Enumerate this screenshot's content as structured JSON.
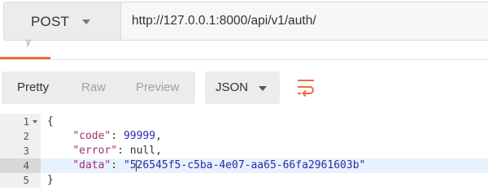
{
  "request": {
    "method": "POST",
    "url": "http://127.0.0.1:8000/api/v1/auth/"
  },
  "tabs": {
    "partial_label": "y"
  },
  "response_toolbar": {
    "views": [
      "Pretty",
      "Raw",
      "Preview"
    ],
    "active_view": "Pretty",
    "format": "JSON",
    "wrap_icon": "wrap-lines-icon"
  },
  "editor": {
    "active_line": 4,
    "lines": [
      {
        "no": "1",
        "open": "{"
      },
      {
        "no": "2",
        "key": "\"code\"",
        "sep": ": ",
        "value": "99999",
        "end": ","
      },
      {
        "no": "3",
        "key": "\"error\"",
        "sep": ": ",
        "value": "null",
        "end": ","
      },
      {
        "no": "4",
        "key": "\"data\"",
        "sep": ": ",
        "value_a": "\"5",
        "value_b": "26545f5-c5ba-4e07-aa65-66fa2961603b\""
      },
      {
        "no": "5",
        "close": "}"
      }
    ]
  },
  "colors": {
    "accent": "#f26b3a",
    "active_line_bg": "#e8f2fe",
    "toolbar_bg": "#ececec"
  }
}
